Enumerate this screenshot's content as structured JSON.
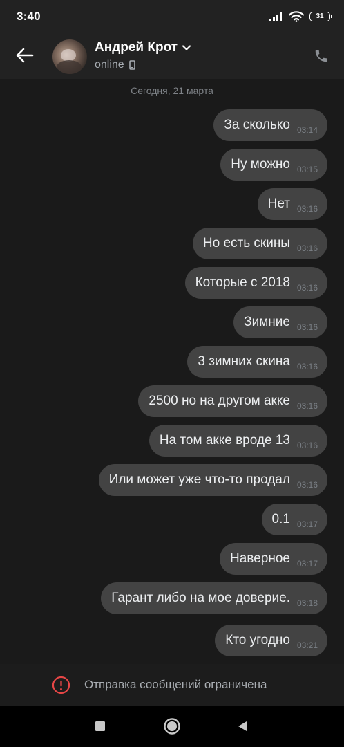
{
  "status_bar": {
    "time": "3:40",
    "battery": "31",
    "icons": [
      "signal-icon",
      "wifi-icon",
      "battery-icon"
    ]
  },
  "header": {
    "contact_name": "Андрей Крот",
    "status": "online",
    "icons": [
      "back-arrow-icon",
      "chevron-down-icon",
      "mobile-device-icon",
      "phone-icon"
    ]
  },
  "chat": {
    "date_separator": "Сегодня, 21 марта",
    "messages": [
      {
        "text": "За сколько",
        "time": "03:14"
      },
      {
        "text": "Ну можно",
        "time": "03:15"
      },
      {
        "text": "Нет",
        "time": "03:16"
      },
      {
        "text": "Но есть скины",
        "time": "03:16"
      },
      {
        "text": "Которые с 2018",
        "time": "03:16"
      },
      {
        "text": "Зимние",
        "time": "03:16"
      },
      {
        "text": "3 зимних скина",
        "time": "03:16"
      },
      {
        "text": "2500 но на другом акке",
        "time": "03:16"
      },
      {
        "text": "На том акке вроде 13",
        "time": "03:16"
      },
      {
        "text": "Или может уже что-то продал",
        "time": "03:16"
      },
      {
        "text": "0.1",
        "time": "03:17"
      },
      {
        "text": "Наверное",
        "time": "03:17"
      },
      {
        "text": "Гарант либо на мое доверие.",
        "time": "03:18"
      },
      {
        "text": "Кто угодно",
        "time": "03:21"
      }
    ]
  },
  "restricted_notice": {
    "text": "Отправка сообщений ограничена",
    "icon": "warning-circle-icon",
    "color": "#e64646"
  },
  "nav_bar": {
    "icons": [
      "recents-square-icon",
      "home-circle-icon",
      "back-triangle-icon"
    ]
  },
  "colors": {
    "background": "#1a1a1a",
    "header": "#222222",
    "bubble": "#434343"
  }
}
